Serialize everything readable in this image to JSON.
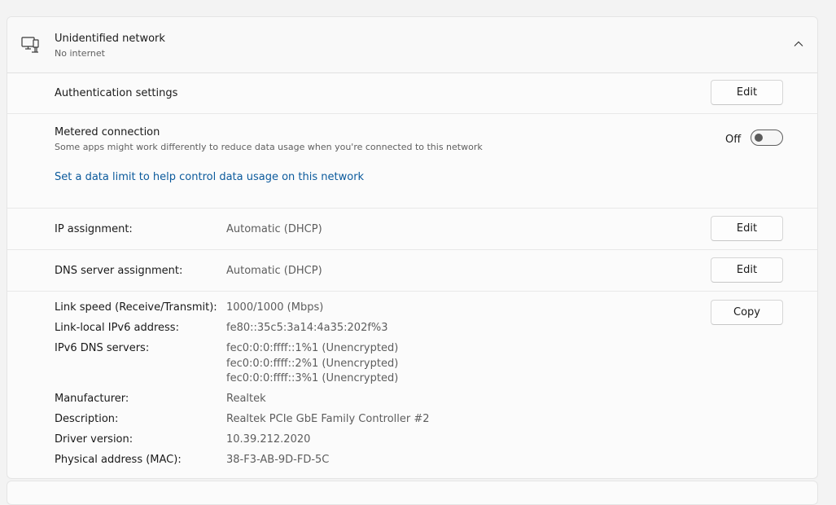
{
  "header": {
    "title": "Unidentified network",
    "subtitle": "No internet",
    "icon": "wired-network-icon",
    "expand_icon": "chevron-up-icon"
  },
  "authentication": {
    "label": "Authentication settings",
    "button": "Edit"
  },
  "metered": {
    "label": "Metered connection",
    "description": "Some apps might work differently to reduce data usage when you're connected to this network",
    "toggle_state": "Off",
    "toggle_on": false,
    "link": "Set a data limit to help control data usage on this network"
  },
  "ip_assignment": {
    "label": "IP assignment:",
    "value": "Automatic (DHCP)",
    "button": "Edit"
  },
  "dns_assignment": {
    "label": "DNS server assignment:",
    "value": "Automatic (DHCP)",
    "button": "Edit"
  },
  "details": {
    "copy_button": "Copy",
    "link_speed": {
      "label": "Link speed (Receive/Transmit):",
      "value": "1000/1000 (Mbps)"
    },
    "link_local_ipv6": {
      "label": "Link-local IPv6 address:",
      "value": "fe80::35c5:3a14:4a35:202f%3"
    },
    "ipv6_dns": {
      "label": "IPv6 DNS servers:",
      "values": [
        "fec0:0:0:ffff::1%1 (Unencrypted)",
        "fec0:0:0:ffff::2%1 (Unencrypted)",
        "fec0:0:0:ffff::3%1 (Unencrypted)"
      ]
    },
    "manufacturer": {
      "label": "Manufacturer:",
      "value": "Realtek"
    },
    "description": {
      "label": "Description:",
      "value": "Realtek PCIe GbE Family Controller #2"
    },
    "driver_version": {
      "label": "Driver version:",
      "value": "10.39.212.2020"
    },
    "mac": {
      "label": "Physical address (MAC):",
      "value": "38-F3-AB-9D-FD-5C"
    }
  },
  "colors": {
    "link": "#0b5a9c",
    "card_background": "#fbfbfb",
    "page_background": "#f3f3f3"
  }
}
